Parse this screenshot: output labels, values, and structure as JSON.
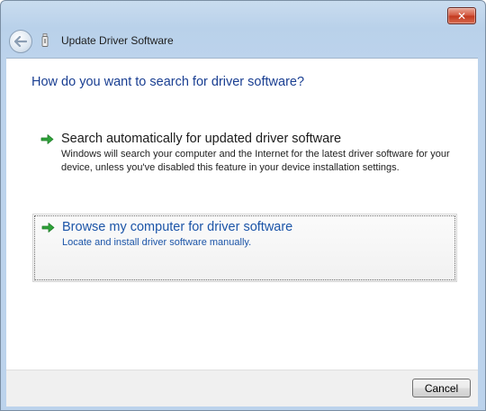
{
  "window": {
    "title": "Update Driver Software",
    "close_glyph": "✕",
    "back_icon": "back-arrow-icon"
  },
  "content": {
    "heading": "How do you want to search for driver software?",
    "options": [
      {
        "title": "Search automatically for updated driver software",
        "description": "Windows will search your computer and the Internet for the latest driver software for your device, unless you've disabled this feature in your device installation settings.",
        "icon": "green-arrow-icon",
        "title_color": "#1b1b1b",
        "desc_color": "#222222"
      },
      {
        "title": "Browse my computer for driver software",
        "description": "Locate and install driver software manually.",
        "icon": "green-arrow-icon",
        "title_color": "#1c55a8",
        "desc_color": "#1c55a8"
      }
    ]
  },
  "footer": {
    "cancel_label": "Cancel"
  },
  "colors": {
    "heading": "#1a3f92",
    "arrow": "#2fa33a",
    "link_blue": "#1c55a8"
  }
}
